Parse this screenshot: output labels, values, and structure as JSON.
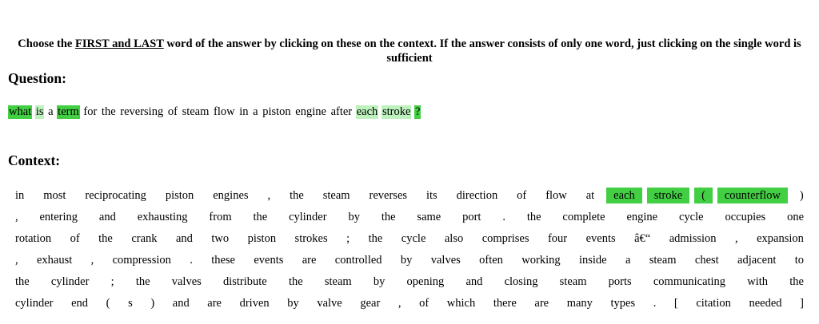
{
  "instructions": {
    "prefix": "Choose the ",
    "underlined": "FIRST and LAST",
    "suffix": " word of the answer by clicking on these on the context. If the answer consists of only one word, just clicking on the single word is sufficient"
  },
  "question_heading": "Question:",
  "question_words": [
    {
      "text": "what",
      "hl": "strong"
    },
    {
      "text": "is",
      "hl": "light"
    },
    {
      "text": "a",
      "hl": ""
    },
    {
      "text": "term",
      "hl": "strong"
    },
    {
      "text": "for",
      "hl": ""
    },
    {
      "text": "the",
      "hl": ""
    },
    {
      "text": "reversing",
      "hl": ""
    },
    {
      "text": "of",
      "hl": ""
    },
    {
      "text": "steam",
      "hl": ""
    },
    {
      "text": "flow",
      "hl": ""
    },
    {
      "text": "in",
      "hl": ""
    },
    {
      "text": "a",
      "hl": ""
    },
    {
      "text": "piston",
      "hl": ""
    },
    {
      "text": "engine",
      "hl": ""
    },
    {
      "text": "after",
      "hl": ""
    },
    {
      "text": "each",
      "hl": "light"
    },
    {
      "text": "stroke",
      "hl": "light"
    },
    {
      "text": "?",
      "hl": "strong"
    }
  ],
  "context_heading": "Context:",
  "context_lines": [
    [
      {
        "text": "in"
      },
      {
        "text": "most"
      },
      {
        "text": "reciprocating"
      },
      {
        "text": "piston"
      },
      {
        "text": "engines"
      },
      {
        "text": ","
      },
      {
        "text": "the"
      },
      {
        "text": "steam"
      },
      {
        "text": "reverses"
      },
      {
        "text": "its"
      },
      {
        "text": "direction"
      },
      {
        "text": "of"
      },
      {
        "text": "flow"
      },
      {
        "text": "at"
      },
      {
        "text": "each",
        "hl": true
      },
      {
        "text": "stroke",
        "hl": true
      },
      {
        "text": "(",
        "hl": true
      },
      {
        "text": "counterflow",
        "hl": true
      },
      {
        "text": ")"
      }
    ],
    [
      {
        "text": ","
      },
      {
        "text": "entering"
      },
      {
        "text": "and"
      },
      {
        "text": "exhausting"
      },
      {
        "text": "from"
      },
      {
        "text": "the"
      },
      {
        "text": "cylinder"
      },
      {
        "text": "by"
      },
      {
        "text": "the"
      },
      {
        "text": "same"
      },
      {
        "text": "port"
      },
      {
        "text": "."
      },
      {
        "text": "the"
      },
      {
        "text": "complete"
      },
      {
        "text": "engine"
      },
      {
        "text": "cycle"
      },
      {
        "text": "occupies"
      },
      {
        "text": "one"
      }
    ],
    [
      {
        "text": "rotation"
      },
      {
        "text": "of"
      },
      {
        "text": "the"
      },
      {
        "text": "crank"
      },
      {
        "text": "and"
      },
      {
        "text": "two"
      },
      {
        "text": "piston"
      },
      {
        "text": "strokes"
      },
      {
        "text": ";"
      },
      {
        "text": "the"
      },
      {
        "text": "cycle"
      },
      {
        "text": "also"
      },
      {
        "text": "comprises"
      },
      {
        "text": "four"
      },
      {
        "text": "events"
      },
      {
        "text": "â€“"
      },
      {
        "text": "admission"
      },
      {
        "text": ","
      },
      {
        "text": "expansion"
      }
    ],
    [
      {
        "text": ","
      },
      {
        "text": "exhaust"
      },
      {
        "text": ","
      },
      {
        "text": "compression"
      },
      {
        "text": "."
      },
      {
        "text": "these"
      },
      {
        "text": "events"
      },
      {
        "text": "are"
      },
      {
        "text": "controlled"
      },
      {
        "text": "by"
      },
      {
        "text": "valves"
      },
      {
        "text": "often"
      },
      {
        "text": "working"
      },
      {
        "text": "inside"
      },
      {
        "text": "a"
      },
      {
        "text": "steam"
      },
      {
        "text": "chest"
      },
      {
        "text": "adjacent"
      },
      {
        "text": "to"
      }
    ],
    [
      {
        "text": "the"
      },
      {
        "text": "cylinder"
      },
      {
        "text": ";"
      },
      {
        "text": "the"
      },
      {
        "text": "valves"
      },
      {
        "text": "distribute"
      },
      {
        "text": "the"
      },
      {
        "text": "steam"
      },
      {
        "text": "by"
      },
      {
        "text": "opening"
      },
      {
        "text": "and"
      },
      {
        "text": "closing"
      },
      {
        "text": "steam"
      },
      {
        "text": "ports"
      },
      {
        "text": "communicating"
      },
      {
        "text": "with"
      },
      {
        "text": "the"
      }
    ],
    [
      {
        "text": "cylinder"
      },
      {
        "text": "end"
      },
      {
        "text": "("
      },
      {
        "text": "s"
      },
      {
        "text": ")"
      },
      {
        "text": "and"
      },
      {
        "text": "are"
      },
      {
        "text": "driven"
      },
      {
        "text": "by"
      },
      {
        "text": "valve"
      },
      {
        "text": "gear"
      },
      {
        "text": ","
      },
      {
        "text": "of"
      },
      {
        "text": "which"
      },
      {
        "text": "there"
      },
      {
        "text": "are"
      },
      {
        "text": "many"
      },
      {
        "text": "types"
      },
      {
        "text": "."
      },
      {
        "text": "["
      },
      {
        "text": "citation"
      },
      {
        "text": "needed"
      },
      {
        "text": "]"
      }
    ]
  ],
  "colors": {
    "highlight_strong": "#43cf43",
    "highlight_light": "#bdf1bd"
  }
}
